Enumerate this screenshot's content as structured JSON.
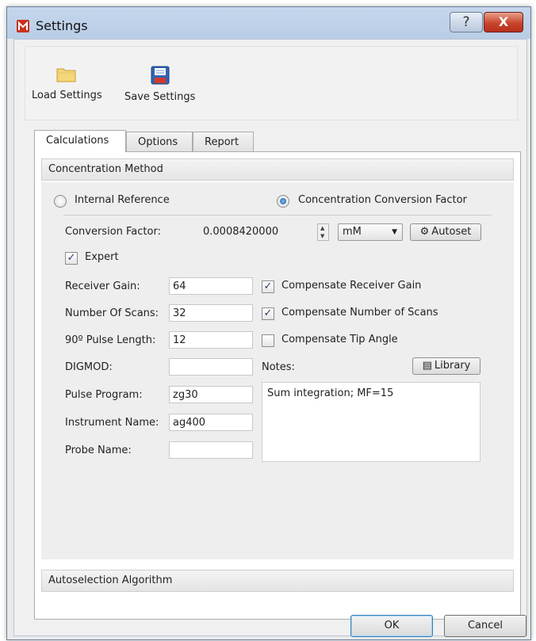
{
  "window": {
    "title": "Settings",
    "help_label": "?",
    "close_label": "X"
  },
  "icons": {
    "app": "app-logo-icon",
    "load": "folder-icon",
    "save": "floppy-disk-icon",
    "autoset": "autoset-icon",
    "library": "library-books-icon"
  },
  "toolbar": {
    "load_label": "Load Settings",
    "save_label": "Save Settings"
  },
  "tabs": [
    {
      "label": "Calculations",
      "active": true
    },
    {
      "label": "Options",
      "active": false
    },
    {
      "label": "Report",
      "active": false
    }
  ],
  "concentration": {
    "header": "Concentration Method",
    "radio_internal": "Internal Reference",
    "radio_ccf": "Concentration Conversion Factor",
    "selected": "Concentration Conversion Factor",
    "conversion_label": "Conversion Factor:",
    "conversion_value": "0.0008420000",
    "unit_value": "mM",
    "autoset_label": "Autoset",
    "expert_label": "Expert",
    "expert_checked": true,
    "fields": {
      "receiver_gain_label": "Receiver Gain:",
      "receiver_gain_value": "64",
      "scans_label": "Number Of Scans:",
      "scans_value": "32",
      "pulse_len_label": "90º Pulse Length:",
      "pulse_len_value": "12",
      "digmod_label": "DIGMOD:",
      "digmod_value": "",
      "pulse_prog_label": "Pulse Program:",
      "pulse_prog_value": "zg30",
      "instrument_label": "Instrument Name:",
      "instrument_value": "ag400",
      "probe_label": "Probe Name:",
      "probe_value": ""
    },
    "compensate_gain_label": "Compensate Receiver Gain",
    "compensate_gain_checked": true,
    "compensate_scans_label": "Compensate Number of Scans",
    "compensate_scans_checked": true,
    "compensate_tip_label": "Compensate Tip Angle",
    "compensate_tip_checked": false,
    "notes_label": "Notes:",
    "library_label": "Library",
    "notes_value": "Sum integration; MF=15"
  },
  "autoselection": {
    "header": "Autoselection Algorithm"
  },
  "dialog": {
    "ok_label": "OK",
    "cancel_label": "Cancel"
  },
  "colors": {
    "title_bar": "#c4d6ec",
    "close_button": "#c8452c",
    "accent": "#1d5fa8"
  }
}
